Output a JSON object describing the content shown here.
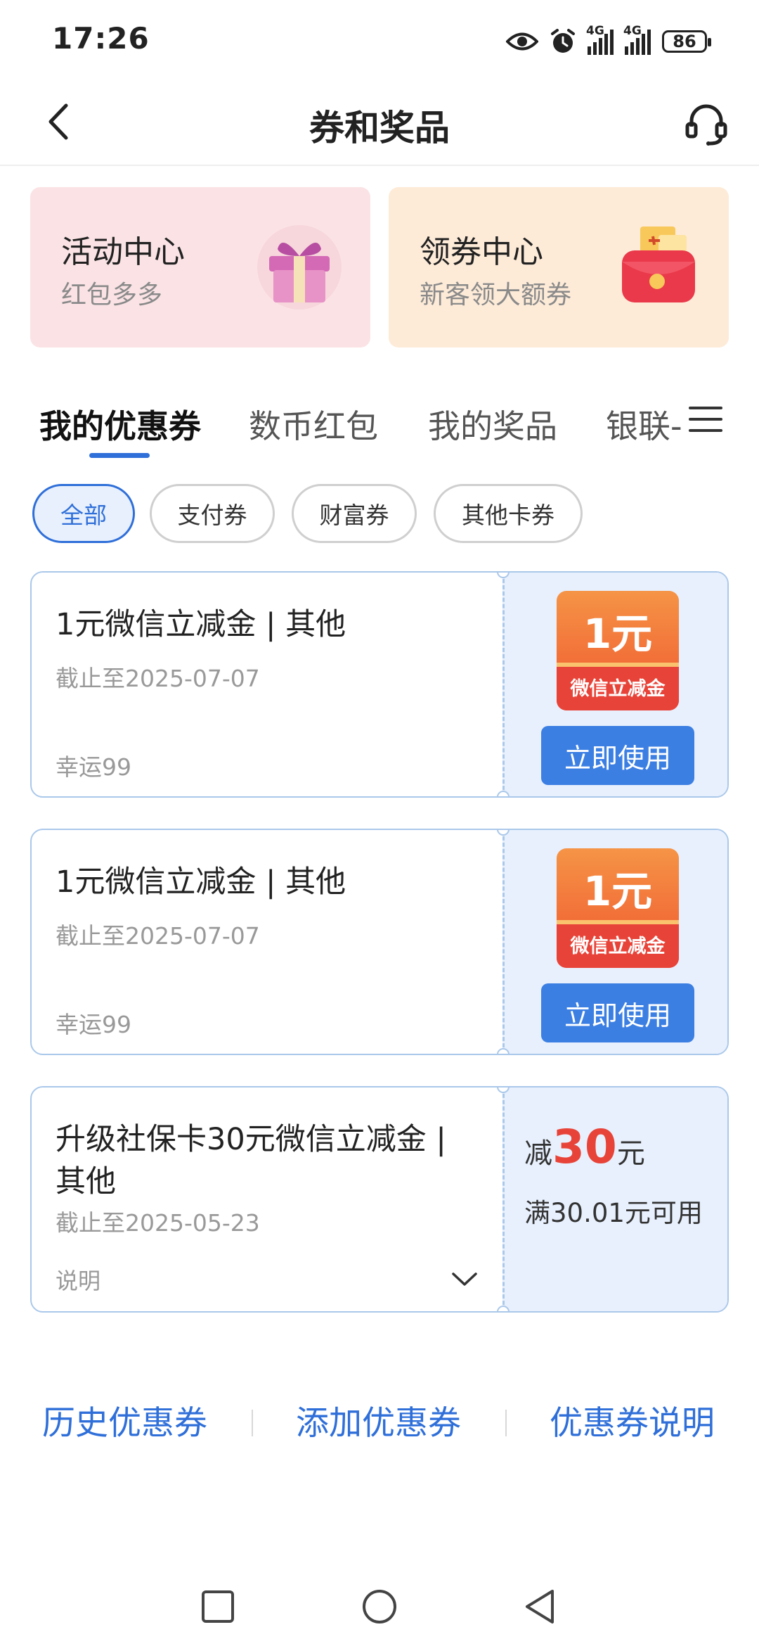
{
  "status": {
    "time": "17:26",
    "net1": "4G",
    "net2": "4G",
    "battery": "86",
    "icons": [
      "eye-icon",
      "alarm-icon",
      "signal-icon",
      "signal-icon",
      "battery-icon"
    ]
  },
  "header": {
    "title": "券和奖品",
    "back_icon": "back-arrow-icon",
    "service_icon": "headset-icon"
  },
  "promos": [
    {
      "title": "活动中心",
      "subtitle": "红包多多",
      "icon": "gift-box-icon"
    },
    {
      "title": "领券中心",
      "subtitle": "新客领大额券",
      "icon": "red-envelope-icon"
    }
  ],
  "tabs": {
    "items": [
      "我的优惠券",
      "数币红包",
      "我的奖品",
      "银联-"
    ],
    "active": "我的优惠券",
    "menu_icon": "menu-icon"
  },
  "filters": {
    "items": [
      "全部",
      "支付券",
      "财富券",
      "其他卡券"
    ],
    "active": "全部"
  },
  "coupons": [
    {
      "title": "1元微信立减金 | 其他",
      "expiry": "截止至2025-07-07",
      "tag": "幸运99",
      "badge_amount": "1元",
      "badge_text": "微信立减金",
      "action": "立即使用"
    },
    {
      "title": "1元微信立减金 | 其他",
      "expiry": "截止至2025-07-07",
      "tag": "幸运99",
      "badge_amount": "1元",
      "badge_text": "微信立减金",
      "action": "立即使用"
    },
    {
      "title": "升级社保卡30元微信立减金 | 其他",
      "expiry": "截止至2025-05-23",
      "note": "说明",
      "discount_prefix": "减",
      "discount_value": "30",
      "discount_unit": "元",
      "condition": "满30.01元可用"
    }
  ],
  "footer": {
    "links": [
      "历史优惠券",
      "添加优惠券",
      "优惠券说明"
    ]
  },
  "navbar": {
    "icons": [
      "recent-apps-icon",
      "home-icon",
      "back-icon"
    ]
  },
  "colors": {
    "accent": "#2f6fd9",
    "button": "#3c7fe3",
    "coupon_right_bg": "#e8f0fd",
    "promo1_bg": "#fbe3e5",
    "promo2_bg": "#fdebd8",
    "discount_red": "#e84338"
  }
}
